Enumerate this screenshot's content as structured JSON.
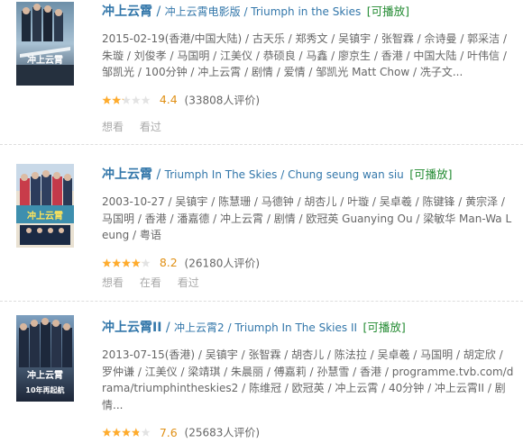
{
  "results": [
    {
      "main_title": "冲上云霄",
      "other_titles": "冲上云霄电影版 / Triumph in the Skies",
      "playable": "[可播放]",
      "abstract": "2015-02-19(香港/中国大陆) / 古天乐 / 郑秀文 / 吴镇宇 / 张智霖 / 佘诗曼 / 郭采洁 / 朱璇 / 刘俊孝 / 马国明 / 江美仪 / 恭硕良 / 马鑫 / 廖京生 / 香港 / 中国大陆 / 叶伟信 / 邹凯光 / 100分钟 / 冲上云霄 / 剧情 / 爱情 / 邹凯光 Matt Chow / 冼子文...",
      "rating": 4.4,
      "rating_num": "4.4",
      "rating_count": "(33808人评价)",
      "actions": [
        "想看",
        "看过"
      ],
      "poster_text": "冲上云霄"
    },
    {
      "main_title": "冲上云霄",
      "other_titles": "Triumph In The Skies / Chung seung wan siu",
      "playable": "[可播放]",
      "abstract": "2003-10-27 / 吴镇宇 / 陈慧珊 / 马德钟 / 胡杏儿 / 叶璇 / 吴卓羲 / 陈键锋 / 黄宗泽 / 马国明 / 香港 / 潘嘉德 / 冲上云霄 / 剧情 / 欧冠英 Guanying Ou / 梁敏华 Man-Wa Leung / 粤语",
      "rating": 8.2,
      "rating_num": "8.2",
      "rating_count": "(26180人评价)",
      "actions": [
        "想看",
        "在看",
        "看过"
      ],
      "poster_text": "冲上云霄"
    },
    {
      "main_title": "冲上云霄II",
      "other_titles": "冲上云霄2 / Triumph In The Skies II",
      "playable": "[可播放]",
      "abstract": "2013-07-15(香港) / 吴镇宇 / 张智霖 / 胡杏儿 / 陈法拉 / 吴卓羲 / 马国明 / 胡定欣 / 罗仲谦 / 江美仪 / 梁靖琪 / 朱晨丽 / 傅嘉莉 / 孙慧雪 / 香港 / programme.tvb.com/drama/triumphintheskies2 / 陈维冠 / 欧冠英 / 冲上云霄 / 40分钟 / 冲上云霄II / 剧情...",
      "rating": 7.6,
      "rating_num": "7.6",
      "rating_count": "(25683人评价)",
      "actions": [],
      "poster_text": "冲上云霄",
      "poster_subtext": "10年再起航"
    }
  ],
  "colors": {
    "link": "#3377aa",
    "playable": "#228a31",
    "star": "#ffac2d",
    "rating": "#e09015"
  }
}
